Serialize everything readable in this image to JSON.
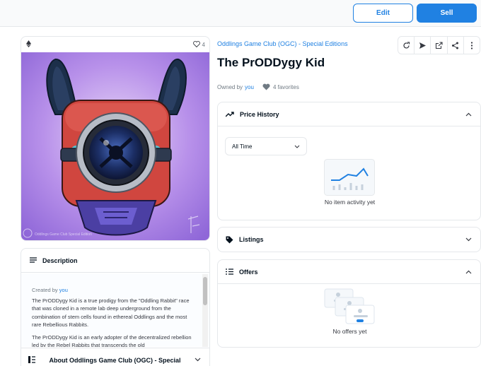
{
  "header": {
    "edit_label": "Edit",
    "sell_label": "Sell"
  },
  "item": {
    "favorite_count": "4",
    "collection": "Oddlings Game Club (OGC) - Special Editions",
    "title": "The PrODDygy Kid",
    "owned_prefix": "Owned by",
    "owner": "you",
    "favorites_text": "4 favorites",
    "image_watermark": "Oddlings Game Club Special Edition"
  },
  "description": {
    "heading": "Description",
    "created_prefix": "Created by",
    "creator": "you",
    "paragraph_1": "The PrODDygy Kid is a true prodigy from the \"Oddling Rabbit\" race that was cloned in a remote lab deep underground from the combination of stem cells found in ethereal Oddlings and the most rare Rebellious Rabbits.",
    "paragraph_2": "The PrODDygy Kid is an early adopter of the decentralized rebellion led by the Rebel Rabbits that transcends the old",
    "about_heading": "About Oddlings Game Club (OGC) - Special Editions"
  },
  "price_history": {
    "heading": "Price History",
    "range_selected": "All Time",
    "empty_text": "No item activity yet"
  },
  "listings": {
    "heading": "Listings"
  },
  "offers": {
    "heading": "Offers",
    "empty_text": "No offers yet"
  },
  "colors": {
    "accent": "#2081e2",
    "text": "#04111d",
    "muted": "#707a83",
    "border": "#e5e8eb"
  },
  "icons": [
    "ethereum-icon",
    "heart-icon",
    "refresh-icon",
    "send-icon",
    "external-link-icon",
    "share-icon",
    "more-vertical-icon",
    "trending-up-icon",
    "tag-icon",
    "list-icon",
    "chevron-up-icon",
    "chevron-down-icon"
  ]
}
